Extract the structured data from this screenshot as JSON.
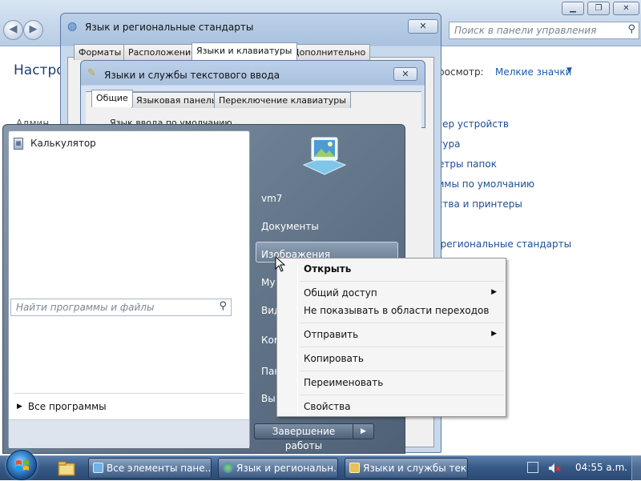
{
  "control_panel": {
    "heading": "Настрой",
    "search_placeholder": "Поиск в панели управления",
    "view_label": "Просмотр:",
    "view_value": "Мелкие значки",
    "left_item": "Админ",
    "links": [
      "тчер устройств",
      "атура",
      "метры папок",
      "аммы по умолчанию",
      "йства и принтеры",
      "ы",
      "и региональные стандарты"
    ]
  },
  "region_dialog": {
    "title": "Язык и региональные стандарты",
    "tabs": [
      "Форматы",
      "Расположение",
      "Языки и клавиатуры",
      "Дополнительно"
    ],
    "close_glyph": "✕"
  },
  "text_services_dialog": {
    "title": "Языки и службы текстового ввода",
    "tabs": [
      "Общие",
      "Языковая панель",
      "Переключение клавиатуры"
    ],
    "default_language_label": "Язык ввода по умолчанию",
    "close_glyph": "✕"
  },
  "start_menu": {
    "pinned": [
      {
        "label": "Калькулятор",
        "icon": "calculator-icon"
      }
    ],
    "all_programs": "Все программы",
    "search_placeholder": "Найти программы и файлы",
    "right_items": [
      "vm7",
      "Документы",
      "Изображения",
      "Му",
      "Вид",
      "Ком",
      "Пан",
      "Вы"
    ],
    "shutdown": "Завершение работы"
  },
  "context_menu": {
    "items": [
      "Открыть",
      "Общий доступ",
      "Не показывать в области переходов",
      "Отправить",
      "Копировать",
      "Переименовать",
      "Свойства"
    ]
  },
  "taskbar": {
    "buttons": [
      "Все элементы пане...",
      "Язык и региональн...",
      "Языки и службы тек..."
    ],
    "clock": "04:55 a.m."
  },
  "colors": {
    "taskbar": "#385a87",
    "link": "#1a4e94",
    "start_menu": "#6b7d91"
  }
}
